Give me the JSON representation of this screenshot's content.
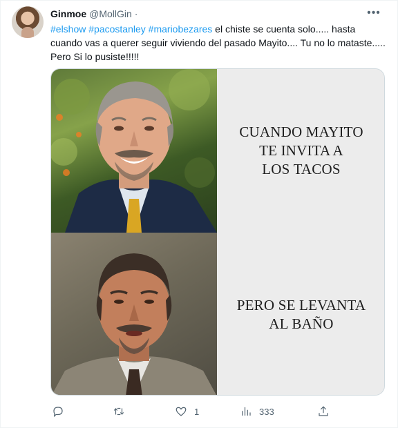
{
  "tweet": {
    "author_name": "Ginmoe",
    "author_handle": "@MollGin",
    "separator": "·",
    "hashtags": [
      "#elshow",
      "#pacostanley",
      "#mariobezares"
    ],
    "body_text": " el chiste se cuenta solo..... hasta cuando vas a querer seguir viviendo del pasado Mayito.... Tu no lo mataste..... Pero Si lo pusiste!!!!!"
  },
  "meme": {
    "top_caption_lines": [
      "CUANDO MAYITO",
      "TE INVITA A",
      "LOS TACOS"
    ],
    "bottom_caption_lines": [
      "PERO SE LEVANTA",
      "AL BAÑO"
    ]
  },
  "actions": {
    "reply_count": "",
    "retweet_count": "",
    "like_count": "1",
    "views_count": "333"
  },
  "icons": {
    "more": "more-dots-icon",
    "reply": "reply-icon",
    "retweet": "retweet-icon",
    "like": "heart-icon",
    "views": "views-chart-icon",
    "share": "share-icon"
  },
  "colors": {
    "link": "#1d9bf0",
    "muted": "#536471",
    "text": "#0f1419",
    "border": "#cfd9de"
  }
}
